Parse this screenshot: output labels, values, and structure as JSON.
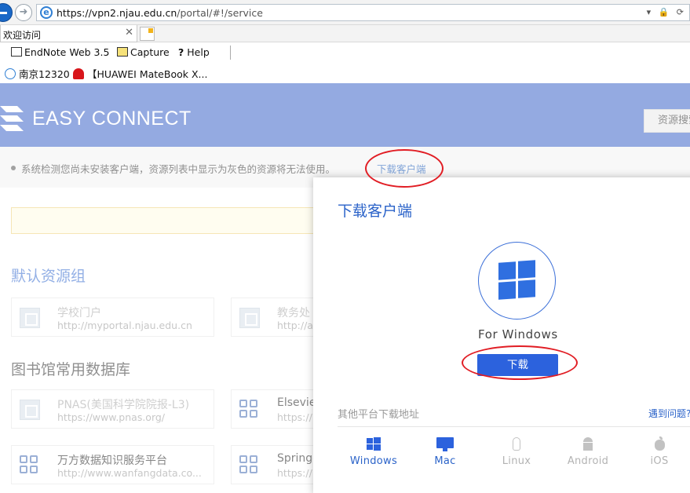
{
  "browser": {
    "url_host": "https://vpn2.njau.edu.cn",
    "url_path": "/portal/#!/service",
    "url_controls": "▾ 🔒 ⟳",
    "tab_title": "欢迎访问",
    "favorites": [
      {
        "label": "EndNote Web 3.5"
      },
      {
        "label": "Capture"
      },
      {
        "label": "Help"
      }
    ],
    "links": [
      {
        "label": "南京12320"
      },
      {
        "label": "【HUAWEI MateBook X..."
      }
    ]
  },
  "header": {
    "brand": "EASY CONNECT",
    "search_label": "资源搜索"
  },
  "notice": {
    "message": "系统检测您尚未安装客户端，资源列表中显示为灰色的资源将无法使用。",
    "download_link": "下载客户端"
  },
  "sections": {
    "default_group": "默认资源组",
    "library_group": "图书馆常用数据库"
  },
  "cards": [
    {
      "name": "学校门户",
      "url": "http://myportal.njau.edu.cn"
    },
    {
      "name": "教务处",
      "url": "http://a"
    },
    {
      "name": "PNAS(美国科学院院报-L3)",
      "url": "https://www.pnas.org/"
    },
    {
      "name": "Elsevie",
      "url": "https://"
    },
    {
      "name": "万方数据知识服务平台",
      "url": "http://www.wanfangdata.co..."
    },
    {
      "name": "Springe",
      "url": "https://"
    }
  ],
  "modal": {
    "title": "下载客户端",
    "platform_name": "For Windows",
    "download_button": "下载",
    "other_platforms_label": "其他平台下载地址",
    "problem_link": "遇到问题?",
    "platforms": [
      {
        "label": "Windows",
        "state": "active"
      },
      {
        "label": "Mac",
        "state": "active"
      },
      {
        "label": "Linux",
        "state": "disabled"
      },
      {
        "label": "Android",
        "state": "disabled"
      },
      {
        "label": "iOS",
        "state": "disabled"
      }
    ]
  },
  "colors": {
    "header_blue": "#3c65c8",
    "accent_blue": "#2c62dd",
    "annotation_red": "#e11d24"
  }
}
